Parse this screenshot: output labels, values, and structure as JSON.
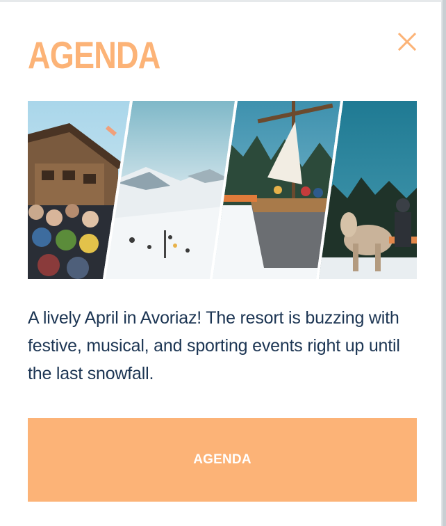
{
  "modal": {
    "title": "AGENDA",
    "close_icon": "close-icon",
    "description": "A lively April in Avoriaz! The resort is buzzing with festive, musical, and sporting events right up until the last snowfall.",
    "button_label": "AGENDA"
  },
  "colors": {
    "accent": "#fcb377",
    "text": "#1c3553",
    "background": "#ffffff"
  }
}
